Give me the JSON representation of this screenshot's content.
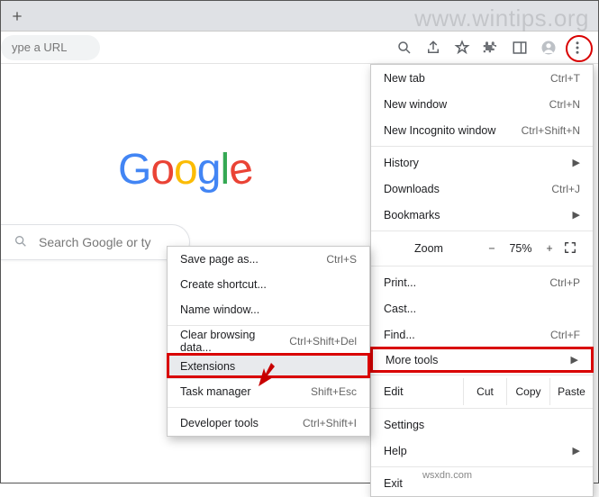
{
  "watermark": "www.wintips.org",
  "footer": "wsxdn.com",
  "omnibox_placeholder": "ype a URL",
  "logo_letters": [
    "G",
    "o",
    "o",
    "g",
    "l",
    "e"
  ],
  "searchbox_placeholder": "Search Google or ty",
  "menu": {
    "newtab": {
      "label": "New tab",
      "shortcut": "Ctrl+T"
    },
    "newwin": {
      "label": "New window",
      "shortcut": "Ctrl+N"
    },
    "incog": {
      "label": "New Incognito window",
      "shortcut": "Ctrl+Shift+N"
    },
    "history": {
      "label": "History"
    },
    "downloads": {
      "label": "Downloads",
      "shortcut": "Ctrl+J"
    },
    "bookmarks": {
      "label": "Bookmarks"
    },
    "zoom": {
      "label": "Zoom",
      "minus": "−",
      "value": "75%",
      "plus": "+"
    },
    "print": {
      "label": "Print...",
      "shortcut": "Ctrl+P"
    },
    "cast": {
      "label": "Cast..."
    },
    "find": {
      "label": "Find...",
      "shortcut": "Ctrl+F"
    },
    "moretools": {
      "label": "More tools"
    },
    "edit": {
      "label": "Edit",
      "cut": "Cut",
      "copy": "Copy",
      "paste": "Paste"
    },
    "settings": {
      "label": "Settings"
    },
    "help": {
      "label": "Help"
    },
    "exit": {
      "label": "Exit"
    }
  },
  "submenu": {
    "savepage": {
      "label": "Save page as...",
      "shortcut": "Ctrl+S"
    },
    "shortcut": {
      "label": "Create shortcut..."
    },
    "namewin": {
      "label": "Name window..."
    },
    "clear": {
      "label": "Clear browsing data...",
      "shortcut": "Ctrl+Shift+Del"
    },
    "extensions": {
      "label": "Extensions"
    },
    "taskmgr": {
      "label": "Task manager",
      "shortcut": "Shift+Esc"
    },
    "devtools": {
      "label": "Developer tools",
      "shortcut": "Ctrl+Shift+I"
    }
  }
}
